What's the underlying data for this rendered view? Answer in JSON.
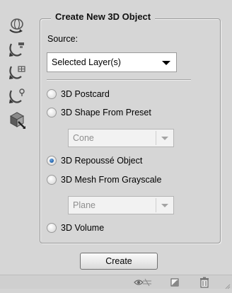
{
  "panel": {
    "group_title": "Create New 3D Object",
    "source_label": "Source:",
    "source_select": {
      "value": "Selected Layer(s)"
    },
    "options": [
      {
        "label": "3D Postcard",
        "checked": false
      },
      {
        "label": "3D Shape From Preset",
        "checked": false
      },
      {
        "label": "3D Repoussé Object",
        "checked": true
      },
      {
        "label": "3D Mesh From Grayscale",
        "checked": false
      },
      {
        "label": "3D Volume",
        "checked": false
      }
    ],
    "preset_select": {
      "value": "Cone"
    },
    "grayscale_select": {
      "value": "Plane"
    },
    "create_button": "Create"
  },
  "tools": [
    "object-rotate-icon",
    "object-roll-icon",
    "object-pan-icon",
    "object-slide-icon",
    "object-scale-icon"
  ],
  "bottom_icons": [
    "toggle-visibility-icon",
    "new-layer-icon",
    "trash-icon"
  ],
  "colors": {
    "panel_bg": "#d6d6d6",
    "radio_selected": "#1f5fa8"
  }
}
